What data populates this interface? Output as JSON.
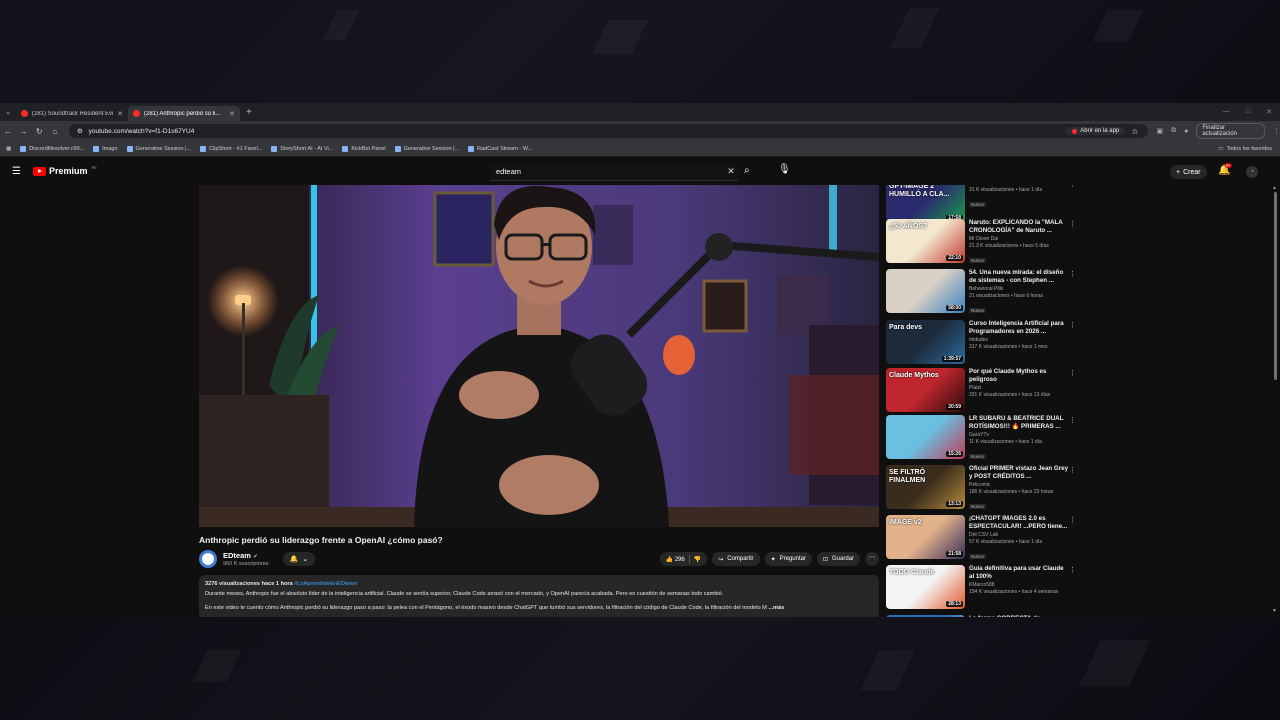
{
  "tabs": [
    {
      "title": "(281) Soundtrack Resident Evil ...",
      "active": false
    },
    {
      "title": "(281) Anthropic perdió su li...",
      "active": true
    }
  ],
  "address": {
    "url": "youtube.com/watch?v=f1-D1s67YU4",
    "open_app_label": "Abrir en la app",
    "update_label": "Finalizar actualización"
  },
  "bookmarks": {
    "items": [
      "Discordfilesolver.c99...",
      "Imago",
      "Generative Session |...",
      "ClipShort - #1 Facel...",
      "StoryShort AI - AI Vi...",
      "KickBot Panel",
      "Generative Session |...",
      "RadCast Stream - W..."
    ],
    "all_label": "Todos los favoritos"
  },
  "header": {
    "logo_word": "Premium",
    "logo_region": "PE",
    "search_query": "edteam",
    "create_label": "Crear",
    "notif_count": "9+"
  },
  "video": {
    "title": "Anthropic perdió su liderazgo frente a OpenAI ¿cómo pasó?",
    "channel": "EDteam",
    "subscribers": "960 K suscriptores",
    "likes": "296",
    "share_label": "Compartir",
    "ask_label": "Preguntar",
    "save_label": "Guardar"
  },
  "description": {
    "views": "3276 visualizaciones",
    "age": "hace 1 hora",
    "hashtag": "#LoAprendisteEnEDteam",
    "line1": "Durante meses, Anthropic fue el absoluto líder de la inteligencia artificial. Claude se sentía superior, Claude Code arrasó con el mercado, y OpenAI parecía acabada. Pero en cuestión de semanas todo cambió.",
    "line2": "En este video te cuento cómo Anthropic perdió su liderazgo paso a paso: la pelea con el Pentágono, el éxodo masivo desde ChatGPT que tumbó sus servidores, la filtración del código de Claude Code, la filtración del modelo M",
    "more": "...más"
  },
  "recommendations": [
    {
      "title": "",
      "channel": "EDteam",
      "meta": "31 K visualizaciones • hace 1 día",
      "badge": "Nuevo",
      "duration": "17:58",
      "thumb_text": "GPT-IMAGE 2 HUMILLÓ A CLA...",
      "colors": [
        "#2a2a6e",
        "#1a9d4a"
      ]
    },
    {
      "title": "Naruto: EXPLICANDO la \"MALA CRONOLOGÍA\" de Naruto ...",
      "channel": "Mr Dioon Dai",
      "meta": "21.3 K visualizaciones • hace 5 días",
      "badge": "Nuevo",
      "duration": "22:10",
      "thumb_text": "¿50 AÑOS?",
      "colors": [
        "#f3e7d0",
        "#c0392b"
      ]
    },
    {
      "title": "54. Una nueva mirada: el diseño de sistemas - con Stephen ...",
      "channel": "Behavioral Pills",
      "meta": "21 visualizaciones • hace 6 horas",
      "badge": "Nuevo",
      "duration": "58:00",
      "thumb_text": "",
      "colors": [
        "#d8d0c4",
        "#3b82c4"
      ]
    },
    {
      "title": "Curso Inteligencia Artificial para Programadores en 2026 ...",
      "channel": "midudev",
      "meta": "317 K visualizaciones • hace 1 mes",
      "badge": "",
      "duration": "1:39:57",
      "thumb_text": "Para devs",
      "colors": [
        "#1c2a3a",
        "#2e6b9e"
      ]
    },
    {
      "title": "Por qué Claude Mythos es peligroso",
      "channel": "Platzi",
      "meta": "331 K visualizaciones • hace 13 días",
      "badge": "",
      "duration": "20:59",
      "thumb_text": "Claude Mythos",
      "colors": [
        "#c0262d",
        "#2b0b0d"
      ]
    },
    {
      "title": "LR SUBARU & BEATRICE DUAL ROTÍSIMOS!!! 🔥 PRIMERAS ...",
      "channel": "GaraYTv",
      "meta": "11 K visualizaciones • hace 1 día",
      "badge": "Nuevo",
      "duration": "15:26",
      "thumb_text": "",
      "colors": [
        "#6ac0e0",
        "#c23a5a"
      ]
    },
    {
      "title": "Oficial PRIMER vistazo Jean Grey y POST CRÉDITOS ...",
      "channel": "Pelicomic",
      "meta": "186 K visualizaciones • hace 23 horas",
      "badge": "Nuevo",
      "duration": "13:13",
      "thumb_text": "SE FILTRÓ FINALMEN",
      "colors": [
        "#3a2c1c",
        "#b58a3c"
      ]
    },
    {
      "title": "¡CHATGPT IMAGES 2.0 es ESPECTACULAR! ...PERO tiene...",
      "channel": "Dot CSV Lab",
      "meta": "57 K visualizaciones • hace 1 día",
      "badge": "Nuevo",
      "duration": "21:58",
      "thumb_text": "IMAGE v2",
      "colors": [
        "#e2b38a",
        "#3a2c5a"
      ]
    },
    {
      "title": "Guía definitiva para usar Claude al 100%",
      "channel": "KMarco588",
      "meta": "154 K visualizaciones • hace 4 semanas",
      "badge": "",
      "duration": "28:13",
      "thumb_text": "TODO Claude",
      "colors": [
        "#f5f5f5",
        "#e05a2a"
      ]
    },
    {
      "title": "La forma CORRECTA de",
      "channel": "",
      "meta": "",
      "badge": "",
      "duration": "",
      "thumb_text": "",
      "colors": [
        "#2a6ab8",
        "#d0d0d0"
      ]
    }
  ]
}
